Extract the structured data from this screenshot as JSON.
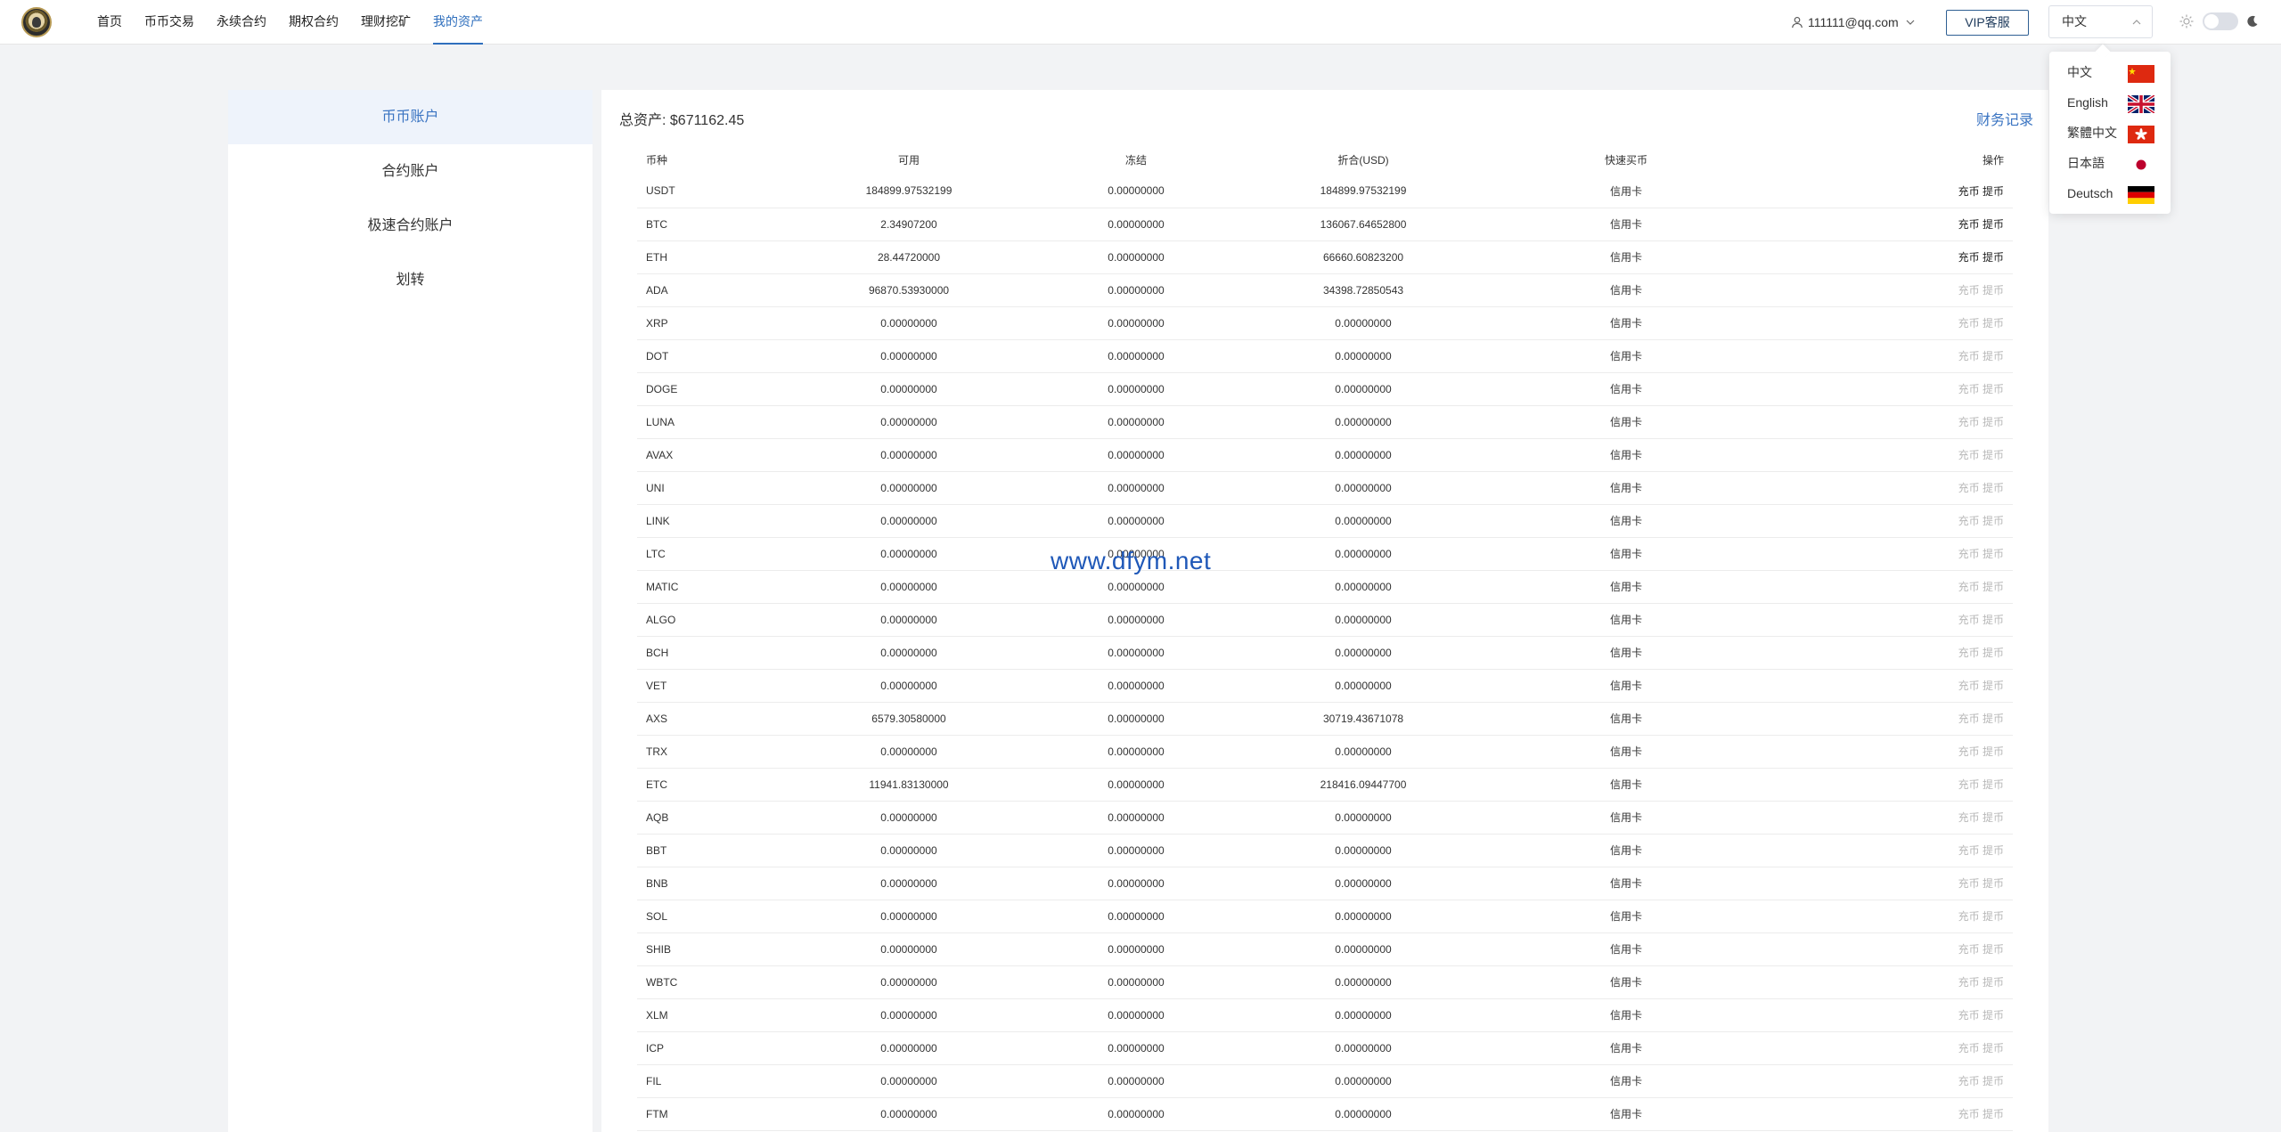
{
  "nav": {
    "items": [
      "首页",
      "币币交易",
      "永续合约",
      "期权合约",
      "理财挖矿",
      "我的资产"
    ],
    "active_index": 5
  },
  "header": {
    "user_email": "111111@qq.com",
    "vip_label": "VIP客服",
    "language_value": "中文"
  },
  "language_dropdown": {
    "options": [
      {
        "label": "中文",
        "flag": "china-flag"
      },
      {
        "label": "English",
        "flag": "uk-flag"
      },
      {
        "label": "繁體中文",
        "flag": "hong-kong-flag"
      },
      {
        "label": "日本語",
        "flag": "japan-flag"
      },
      {
        "label": "Deutsch",
        "flag": "germany-flag"
      }
    ]
  },
  "sidebar": {
    "items": [
      "币币账户",
      "合约账户",
      "极速合约账户",
      "划转"
    ],
    "active_index": 0
  },
  "main": {
    "total_label": "总资产: $671162.45",
    "records_label": "财务记录",
    "columns": [
      "币种",
      "可用",
      "冻结",
      "折合(USD)",
      "快速买币",
      "操作"
    ],
    "deposit_label": "充币",
    "withdraw_label": "提币",
    "rows": [
      {
        "coin": "USDT",
        "available": "184899.97532199",
        "frozen": "0.00000000",
        "usd": "184899.97532199",
        "fast": "信用卡",
        "enabled": true
      },
      {
        "coin": "BTC",
        "available": "2.34907200",
        "frozen": "0.00000000",
        "usd": "136067.64652800",
        "fast": "信用卡",
        "enabled": true
      },
      {
        "coin": "ETH",
        "available": "28.44720000",
        "frozen": "0.00000000",
        "usd": "66660.60823200",
        "fast": "信用卡",
        "enabled": true
      },
      {
        "coin": "ADA",
        "available": "96870.53930000",
        "frozen": "0.00000000",
        "usd": "34398.72850543",
        "fast": "信用卡",
        "enabled": false
      },
      {
        "coin": "XRP",
        "available": "0.00000000",
        "frozen": "0.00000000",
        "usd": "0.00000000",
        "fast": "信用卡",
        "enabled": false
      },
      {
        "coin": "DOT",
        "available": "0.00000000",
        "frozen": "0.00000000",
        "usd": "0.00000000",
        "fast": "信用卡",
        "enabled": false
      },
      {
        "coin": "DOGE",
        "available": "0.00000000",
        "frozen": "0.00000000",
        "usd": "0.00000000",
        "fast": "信用卡",
        "enabled": false
      },
      {
        "coin": "LUNA",
        "available": "0.00000000",
        "frozen": "0.00000000",
        "usd": "0.00000000",
        "fast": "信用卡",
        "enabled": false
      },
      {
        "coin": "AVAX",
        "available": "0.00000000",
        "frozen": "0.00000000",
        "usd": "0.00000000",
        "fast": "信用卡",
        "enabled": false
      },
      {
        "coin": "UNI",
        "available": "0.00000000",
        "frozen": "0.00000000",
        "usd": "0.00000000",
        "fast": "信用卡",
        "enabled": false
      },
      {
        "coin": "LINK",
        "available": "0.00000000",
        "frozen": "0.00000000",
        "usd": "0.00000000",
        "fast": "信用卡",
        "enabled": false
      },
      {
        "coin": "LTC",
        "available": "0.00000000",
        "frozen": "0.00000000",
        "usd": "0.00000000",
        "fast": "信用卡",
        "enabled": false
      },
      {
        "coin": "MATIC",
        "available": "0.00000000",
        "frozen": "0.00000000",
        "usd": "0.00000000",
        "fast": "信用卡",
        "enabled": false
      },
      {
        "coin": "ALGO",
        "available": "0.00000000",
        "frozen": "0.00000000",
        "usd": "0.00000000",
        "fast": "信用卡",
        "enabled": false
      },
      {
        "coin": "BCH",
        "available": "0.00000000",
        "frozen": "0.00000000",
        "usd": "0.00000000",
        "fast": "信用卡",
        "enabled": false
      },
      {
        "coin": "VET",
        "available": "0.00000000",
        "frozen": "0.00000000",
        "usd": "0.00000000",
        "fast": "信用卡",
        "enabled": false
      },
      {
        "coin": "AXS",
        "available": "6579.30580000",
        "frozen": "0.00000000",
        "usd": "30719.43671078",
        "fast": "信用卡",
        "enabled": false
      },
      {
        "coin": "TRX",
        "available": "0.00000000",
        "frozen": "0.00000000",
        "usd": "0.00000000",
        "fast": "信用卡",
        "enabled": false
      },
      {
        "coin": "ETC",
        "available": "11941.83130000",
        "frozen": "0.00000000",
        "usd": "218416.09447700",
        "fast": "信用卡",
        "enabled": false
      },
      {
        "coin": "AQB",
        "available": "0.00000000",
        "frozen": "0.00000000",
        "usd": "0.00000000",
        "fast": "信用卡",
        "enabled": false
      },
      {
        "coin": "BBT",
        "available": "0.00000000",
        "frozen": "0.00000000",
        "usd": "0.00000000",
        "fast": "信用卡",
        "enabled": false
      },
      {
        "coin": "BNB",
        "available": "0.00000000",
        "frozen": "0.00000000",
        "usd": "0.00000000",
        "fast": "信用卡",
        "enabled": false
      },
      {
        "coin": "SOL",
        "available": "0.00000000",
        "frozen": "0.00000000",
        "usd": "0.00000000",
        "fast": "信用卡",
        "enabled": false
      },
      {
        "coin": "SHIB",
        "available": "0.00000000",
        "frozen": "0.00000000",
        "usd": "0.00000000",
        "fast": "信用卡",
        "enabled": false
      },
      {
        "coin": "WBTC",
        "available": "0.00000000",
        "frozen": "0.00000000",
        "usd": "0.00000000",
        "fast": "信用卡",
        "enabled": false
      },
      {
        "coin": "XLM",
        "available": "0.00000000",
        "frozen": "0.00000000",
        "usd": "0.00000000",
        "fast": "信用卡",
        "enabled": false
      },
      {
        "coin": "ICP",
        "available": "0.00000000",
        "frozen": "0.00000000",
        "usd": "0.00000000",
        "fast": "信用卡",
        "enabled": false
      },
      {
        "coin": "FIL",
        "available": "0.00000000",
        "frozen": "0.00000000",
        "usd": "0.00000000",
        "fast": "信用卡",
        "enabled": false
      },
      {
        "coin": "FTM",
        "available": "0.00000000",
        "frozen": "0.00000000",
        "usd": "0.00000000",
        "fast": "信用卡",
        "enabled": false
      }
    ]
  },
  "watermark": "www.dfym.net",
  "colors": {
    "accent": "#2f6fbd",
    "link": "#3a74c2",
    "page_bg": "#f2f3f5",
    "disabled_text": "#b8b8b8"
  }
}
